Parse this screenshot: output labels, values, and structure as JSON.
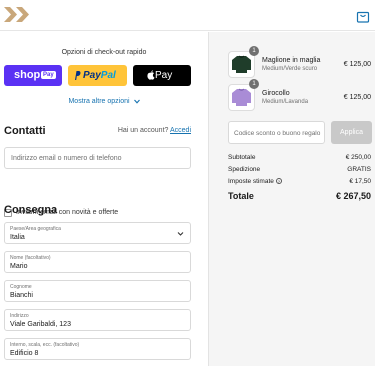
{
  "header": {
    "logo_icon": "double-chevron-logo",
    "cart_icon": "shopping-bag-icon"
  },
  "express": {
    "title": "Opzioni di check-out rapido",
    "shoppay_label": "shop",
    "shoppay_badge": "Pay",
    "paypal_p1": "Pay",
    "paypal_p2": "Pal",
    "applepay_label": "Pay",
    "more_options": "Mostra altre opzioni"
  },
  "contact": {
    "title": "Contatti",
    "login_prompt": "Hai un account?",
    "login_link": "Accedi",
    "email_placeholder": "Indirizzo email o numero di telefono",
    "newsletter_label": "Inviami email con novità e offerte"
  },
  "delivery": {
    "title": "Consegna",
    "country_label": "Paese/Area geografica",
    "country_value": "Italia",
    "first_name_label": "Nome (facoltativo)",
    "first_name_value": "Mario",
    "last_name_label": "Cognome",
    "last_name_value": "Bianchi",
    "address_label": "Indirizzo",
    "address_value": "Viale Garibaldi, 123",
    "address2_label": "Interno, scala, ecc. (facoltativo)",
    "address2_value": "Edificio 8"
  },
  "cart": {
    "items": [
      {
        "name": "Maglione in maglia",
        "variant": "Medium/Verde scuro",
        "price": "€ 125,00",
        "qty": "1",
        "color": "#1f3d2a"
      },
      {
        "name": "Girocollo",
        "variant": "Medium/Lavanda",
        "price": "€ 125,00",
        "qty": "1",
        "color": "#a98cd6"
      }
    ],
    "discount_placeholder": "Codice sconto o buono regalo",
    "apply_label": "Applica",
    "subtotal_label": "Subtotale",
    "subtotal_value": "€ 250,00",
    "shipping_label": "Spedizione",
    "shipping_value": "GRATIS",
    "taxes_label": "Imposte stimate",
    "taxes_value": "€ 17,50",
    "total_label": "Totale",
    "total_value": "€ 267,50"
  },
  "colors": {
    "accent": "#1773b0",
    "shoppay": "#5a31f4",
    "paypal": "#ffc439",
    "applepay": "#000000"
  }
}
